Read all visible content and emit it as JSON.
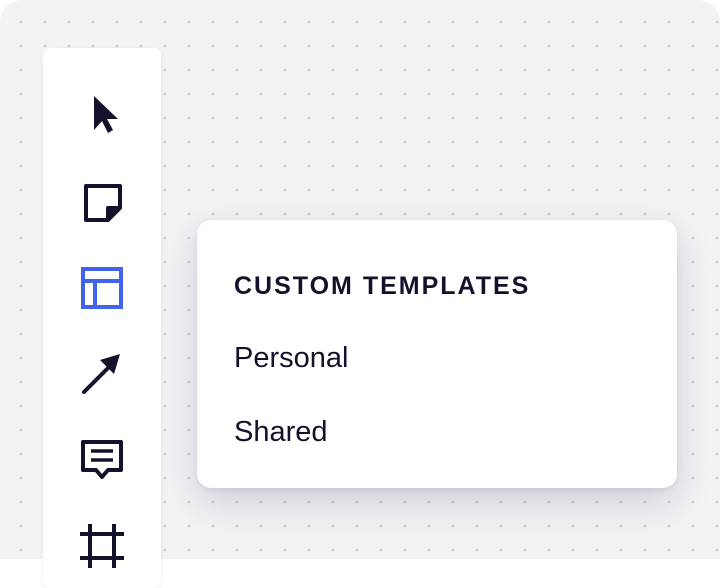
{
  "toolbar": {
    "tools": [
      {
        "name": "select",
        "icon": "cursor-icon",
        "active": false
      },
      {
        "name": "sticky-note",
        "icon": "sticky-note-icon",
        "active": false
      },
      {
        "name": "templates",
        "icon": "template-layout-icon",
        "active": true
      },
      {
        "name": "connector",
        "icon": "arrow-icon",
        "active": false
      },
      {
        "name": "comment",
        "icon": "comment-icon",
        "active": false
      },
      {
        "name": "frame",
        "icon": "frame-icon",
        "active": false
      }
    ]
  },
  "menu": {
    "heading": "CUSTOM TEMPLATES",
    "items": [
      {
        "label": "Personal"
      },
      {
        "label": "Shared"
      }
    ]
  },
  "colors": {
    "icon": "#12122b",
    "active_icon": "#4263eb",
    "canvas": "#f3f3f5",
    "dot": "#cfcfd6"
  }
}
